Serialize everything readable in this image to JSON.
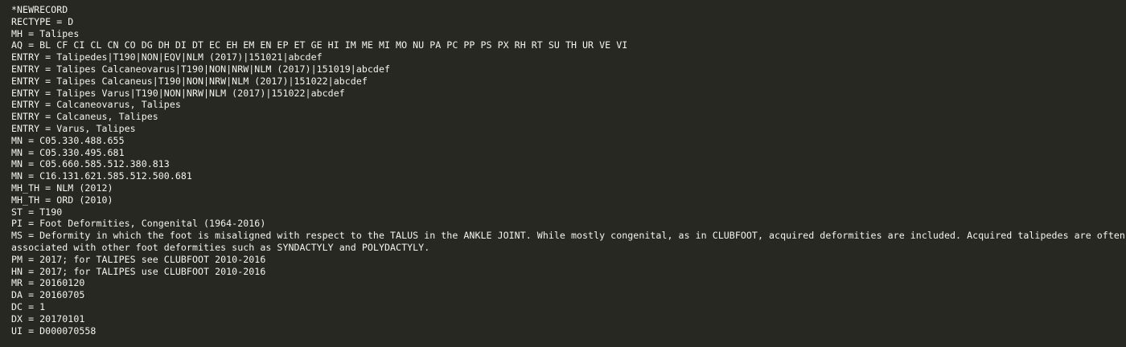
{
  "record": {
    "lines": [
      "*NEWRECORD",
      "RECTYPE = D",
      "MH = Talipes",
      "AQ = BL CF CI CL CN CO DG DH DI DT EC EH EM EN EP ET GE HI IM ME MI MO NU PA PC PP PS PX RH RT SU TH UR VE VI",
      "ENTRY = Talipedes|T190|NON|EQV|NLM (2017)|151021|abcdef",
      "ENTRY = Talipes Calcaneovarus|T190|NON|NRW|NLM (2017)|151019|abcdef",
      "ENTRY = Talipes Calcaneus|T190|NON|NRW|NLM (2017)|151022|abcdef",
      "ENTRY = Talipes Varus|T190|NON|NRW|NLM (2017)|151022|abcdef",
      "ENTRY = Calcaneovarus, Talipes",
      "ENTRY = Calcaneus, Talipes",
      "ENTRY = Varus, Talipes",
      "MN = C05.330.488.655",
      "MN = C05.330.495.681",
      "MN = C05.660.585.512.380.813",
      "MN = C16.131.621.585.512.500.681",
      "MH_TH = NLM (2012)",
      "MH_TH = ORD (2010)",
      "ST = T190",
      "PI = Foot Deformities, Congenital (1964-2016)",
      "MS = Deformity in which the foot is misaligned with respect to the TALUS in the ANKLE JOINT. While mostly congenital, as in CLUBFOOT, acquired deformities are included. Acquired talipedes are often",
      "associated with other foot deformities such as SYNDACTYLY and POLYDACTYLY.",
      "PM = 2017; for TALIPES see CLUBFOOT 2010-2016",
      "HN = 2017; for TALIPES use CLUBFOOT 2010-2016",
      "MR = 20160120",
      "DA = 20160705",
      "DC = 1",
      "DX = 20170101",
      "UI = D000070558"
    ]
  },
  "colors": {
    "background": "#272822",
    "text": "#f4f4ef"
  }
}
